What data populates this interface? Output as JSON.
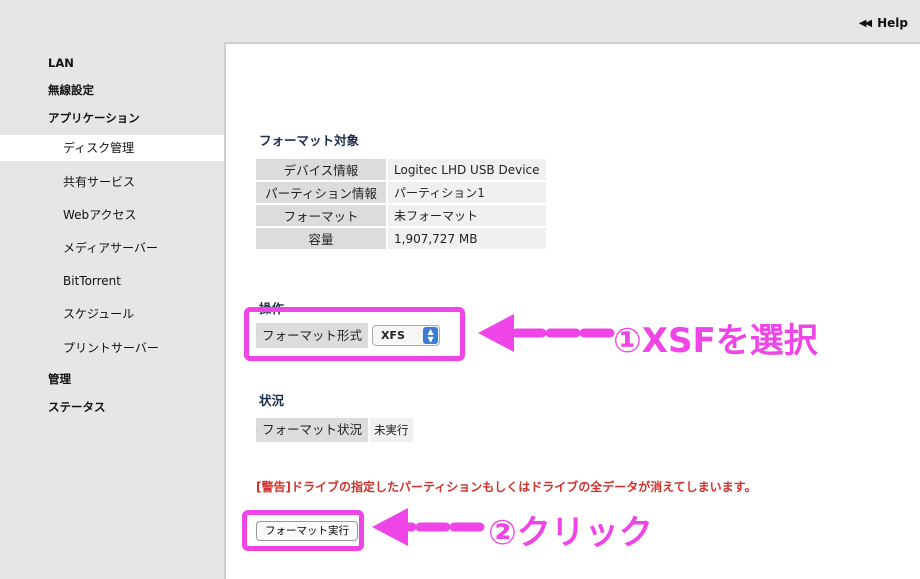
{
  "header": {
    "help_arrows": "◀◀",
    "help_label": "Help"
  },
  "sidebar": {
    "items": [
      {
        "label": "LAN"
      },
      {
        "label": "無線設定"
      },
      {
        "label": "アプリケーション"
      },
      {
        "label": "ディスク管理"
      },
      {
        "label": "共有サービス"
      },
      {
        "label": "Webアクセス"
      },
      {
        "label": "メディアサーバー"
      },
      {
        "label": "BitTorrent"
      },
      {
        "label": "スケジュール"
      },
      {
        "label": "プリントサーバー"
      },
      {
        "label": "管理"
      },
      {
        "label": "ステータス"
      }
    ]
  },
  "main": {
    "target_title": "フォーマット対象",
    "target_rows": [
      {
        "key": "デバイス情報",
        "value": "Logitec LHD USB Device"
      },
      {
        "key": "パーティション情報",
        "value": "パーティション1"
      },
      {
        "key": "フォーマット",
        "value": "未フォーマット"
      },
      {
        "key": "容量",
        "value": "1,907,727 MB"
      }
    ],
    "operation_title": "操作",
    "format_type_label": "フォーマット形式",
    "format_type_value": "XFS",
    "status_title": "状況",
    "format_status_label": "フォーマット状況",
    "format_status_value": "未実行",
    "warning": "[警告]ドライブの指定したパーティションもしくはドライブの全データが消えてしまいます。",
    "execute_button": "フォーマット実行"
  },
  "annotations": {
    "step1": "①XSFを選択",
    "step2": "②クリック",
    "highlight_color": "#f045e6"
  }
}
